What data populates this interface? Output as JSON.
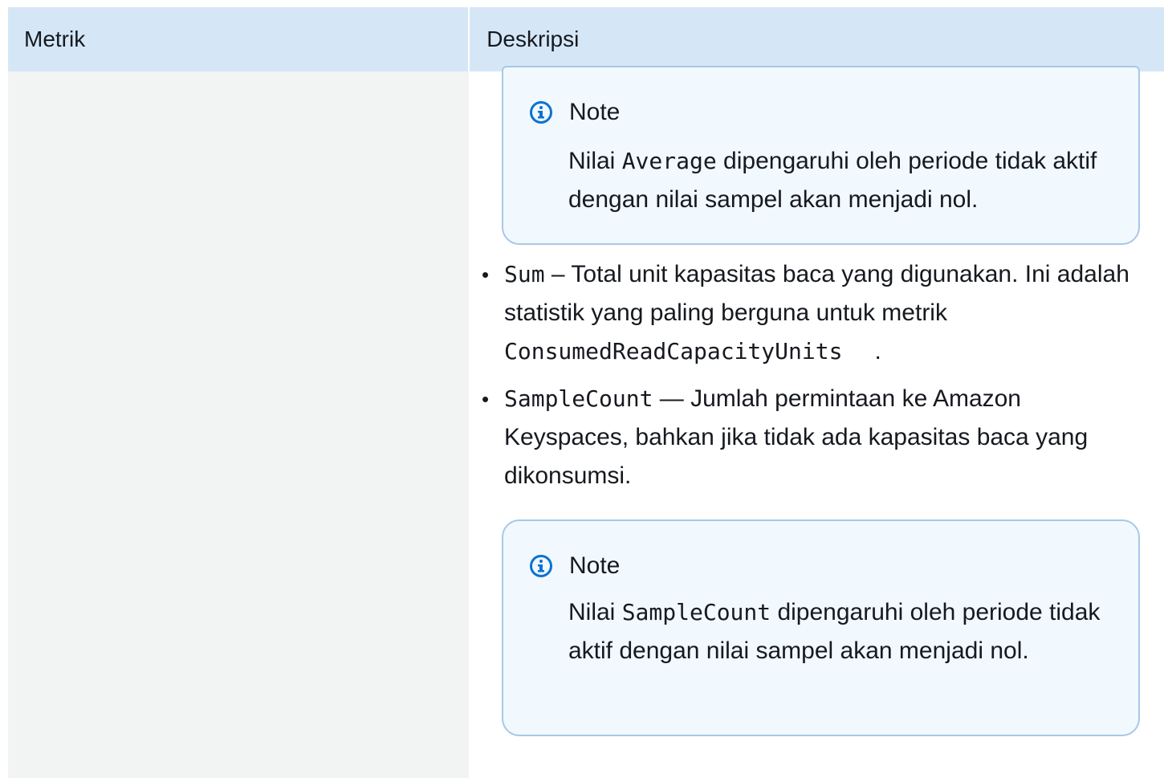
{
  "table": {
    "headers": {
      "metric": "Metrik",
      "description": "Deskripsi"
    }
  },
  "notes": [
    {
      "title": "Note",
      "text_prefix": "Nilai ",
      "code": "Average",
      "text_suffix": " dipengaruhi oleh periode tidak aktif dengan nilai sampel akan menjadi nol."
    },
    {
      "title": "Note",
      "text_prefix": "Nilai ",
      "code": "SampleCount",
      "text_suffix": " dipengaruhi oleh periode tidak aktif dengan nilai sampel akan menjadi nol."
    }
  ],
  "bullets": [
    {
      "code": "Sum",
      "text": " – Total unit kapasitas baca yang digunakan. Ini adalah statistik yang paling berguna untuk metrik ",
      "code2": "ConsumedReadCapacityUnits",
      "tail": "."
    },
    {
      "code": "SampleCount",
      "text": " — Jumlah permintaan ke Amazon Keyspaces, bahkan jika tidak ada kapasitas baca yang dikonsumsi."
    }
  ],
  "icons": {
    "info": "info-icon"
  },
  "colors": {
    "header_bg": "#d5e7f7",
    "left_col_bg": "#f2f3f3",
    "note_bg": "#f1f8fe",
    "note_border": "#a8c8e6",
    "info_icon": "#0972d3"
  }
}
